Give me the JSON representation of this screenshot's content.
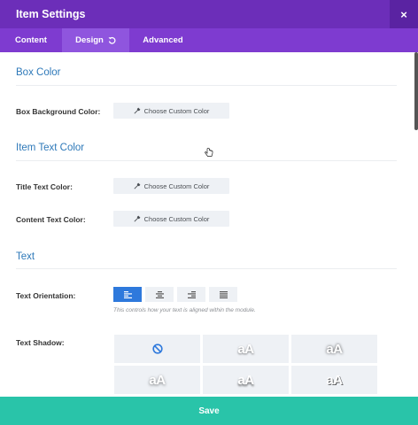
{
  "header": {
    "title": "Item Settings",
    "close_symbol": "×"
  },
  "tabs": [
    {
      "label": "Content"
    },
    {
      "label": "Design"
    },
    {
      "label": "Advanced"
    }
  ],
  "active_tab": "Design",
  "sections": {
    "box_color": {
      "title": "Box Color",
      "background_label": "Box Background Color:",
      "background_button": "Choose Custom Color"
    },
    "item_text_color": {
      "title": "Item Text Color",
      "title_label": "Title Text Color:",
      "title_button": "Choose Custom Color",
      "content_label": "Content Text Color:",
      "content_button": "Choose Custom Color"
    },
    "text": {
      "title": "Text",
      "orientation_label": "Text Orientation:",
      "orientation_options": [
        "left",
        "center",
        "right",
        "justify"
      ],
      "orientation_selected": "left",
      "orientation_help": "This controls how your text is aligned within the module.",
      "shadow_label": "Text Shadow:",
      "shadow_none_icon": "no-symbol-icon",
      "shadow_samples": [
        "aA",
        "aA",
        "aA",
        "aA",
        "aA"
      ]
    }
  },
  "footer": {
    "save_label": "Save"
  },
  "colors": {
    "header": "#6c2eb9",
    "tabs": "#7e3bd0",
    "active_tab": "#8f55de",
    "section_title": "#2e79b9",
    "active_align": "#2e79dc",
    "save": "#29c4a9"
  }
}
